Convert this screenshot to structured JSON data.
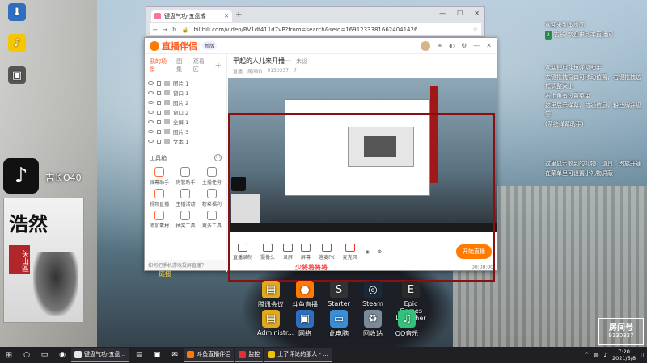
{
  "desktop": {
    "left_icons": [
      {
        "label": "",
        "icon": "download-icon"
      },
      {
        "label": "",
        "icon": "music-app-icon"
      },
      {
        "label": "",
        "icon": "app-icon"
      }
    ],
    "tiktok_text": "吉长O40",
    "poster": {
      "title": "浩然",
      "tag": "关山區"
    },
    "bottom_icons": [
      {
        "label": "腾讯会议",
        "icon": "folder-icon"
      },
      {
        "label": "斗鱼直播伴侣",
        "icon": "live-icon"
      },
      {
        "label": "Starter",
        "icon": "starter-icon"
      },
      {
        "label": "Steam",
        "icon": "steam-icon"
      },
      {
        "label": "Epic Games Launcher",
        "icon": "epic-icon"
      },
      {
        "label": "Administr...",
        "icon": "user-folder-icon"
      },
      {
        "label": "网络",
        "icon": "network-icon"
      },
      {
        "label": "此电脑",
        "icon": "computer-icon"
      },
      {
        "label": "回收站",
        "icon": "recycle-icon"
      },
      {
        "label": "QQ音乐",
        "icon": "qqmusic-icon"
      }
    ]
  },
  "browser": {
    "tab_title": "键盘气功-五盘成",
    "url": "bilibili.com/video/BV1dt411d7vP?from=search&seid=16912333816624041426"
  },
  "live_app": {
    "logo": "直播伴侣",
    "tag": "新版",
    "sidebar_tabs": [
      "我的场景",
      "图集",
      "观看区"
    ],
    "scenes": [
      "图片 1",
      "窗口 1",
      "图片 2",
      "窗口 2",
      "全屏 1",
      "图片 3",
      "文本 1"
    ],
    "tools_title": "工具箱",
    "tools": [
      "弹幕助手",
      "房管助手",
      "主播任务",
      "视频直播",
      "主播活动",
      "粉丝福利",
      "添加素材",
      "抽奖工具",
      "更多工具",
      "",
      "",
      ""
    ],
    "notice": "如何把手机游戏投屏直播？",
    "stream_title": "平起的人儿来开播一",
    "stream_sub": "未设",
    "meta": [
      "直播",
      "房间ID",
      "9130337",
      "7"
    ],
    "controls": [
      "直播录制",
      "摄像头",
      "录屏",
      "屏幕",
      "连麦PK",
      "麦克风"
    ],
    "start_label": "开始直播",
    "timer": "00:00:00"
  },
  "overlay": {
    "welcome": "欢迎来到本房间",
    "chat_user": "吉长",
    "chat_badge": "2",
    "chat_msg": "欢迎来到本直播间",
    "notes_1": [
      "欢迎使用斗鱼弹幕助手",
      "左键拖拽窗口可移动位置，右键拖拽边框调整大小",
      "右上角有设置菜单",
      "这里展示弹幕、普通信息、粉丝牌升级等",
      "(系统弹幕助手)"
    ],
    "notes_2": [
      "这里显示收到的礼物、道具、贵族开通",
      "在菜单里可设置小礼物屏蔽"
    ]
  },
  "stream_overlay": {
    "caption": "少将将将将",
    "link": "链接"
  },
  "taskbar": {
    "tasks": [
      {
        "label": "键盘气功-五盘...",
        "color": "#e8e8e8"
      },
      {
        "label": "斗鱼直播伴侣",
        "color": "#ff7a00"
      },
      {
        "label": "监控",
        "color": "#d33"
      },
      {
        "label": "上了评论的那人 - ...",
        "color": "#f2c200"
      }
    ],
    "time": "7:20",
    "date": "2021/5/8"
  },
  "watermark": {
    "brand": "房间号",
    "room": "9130337"
  }
}
